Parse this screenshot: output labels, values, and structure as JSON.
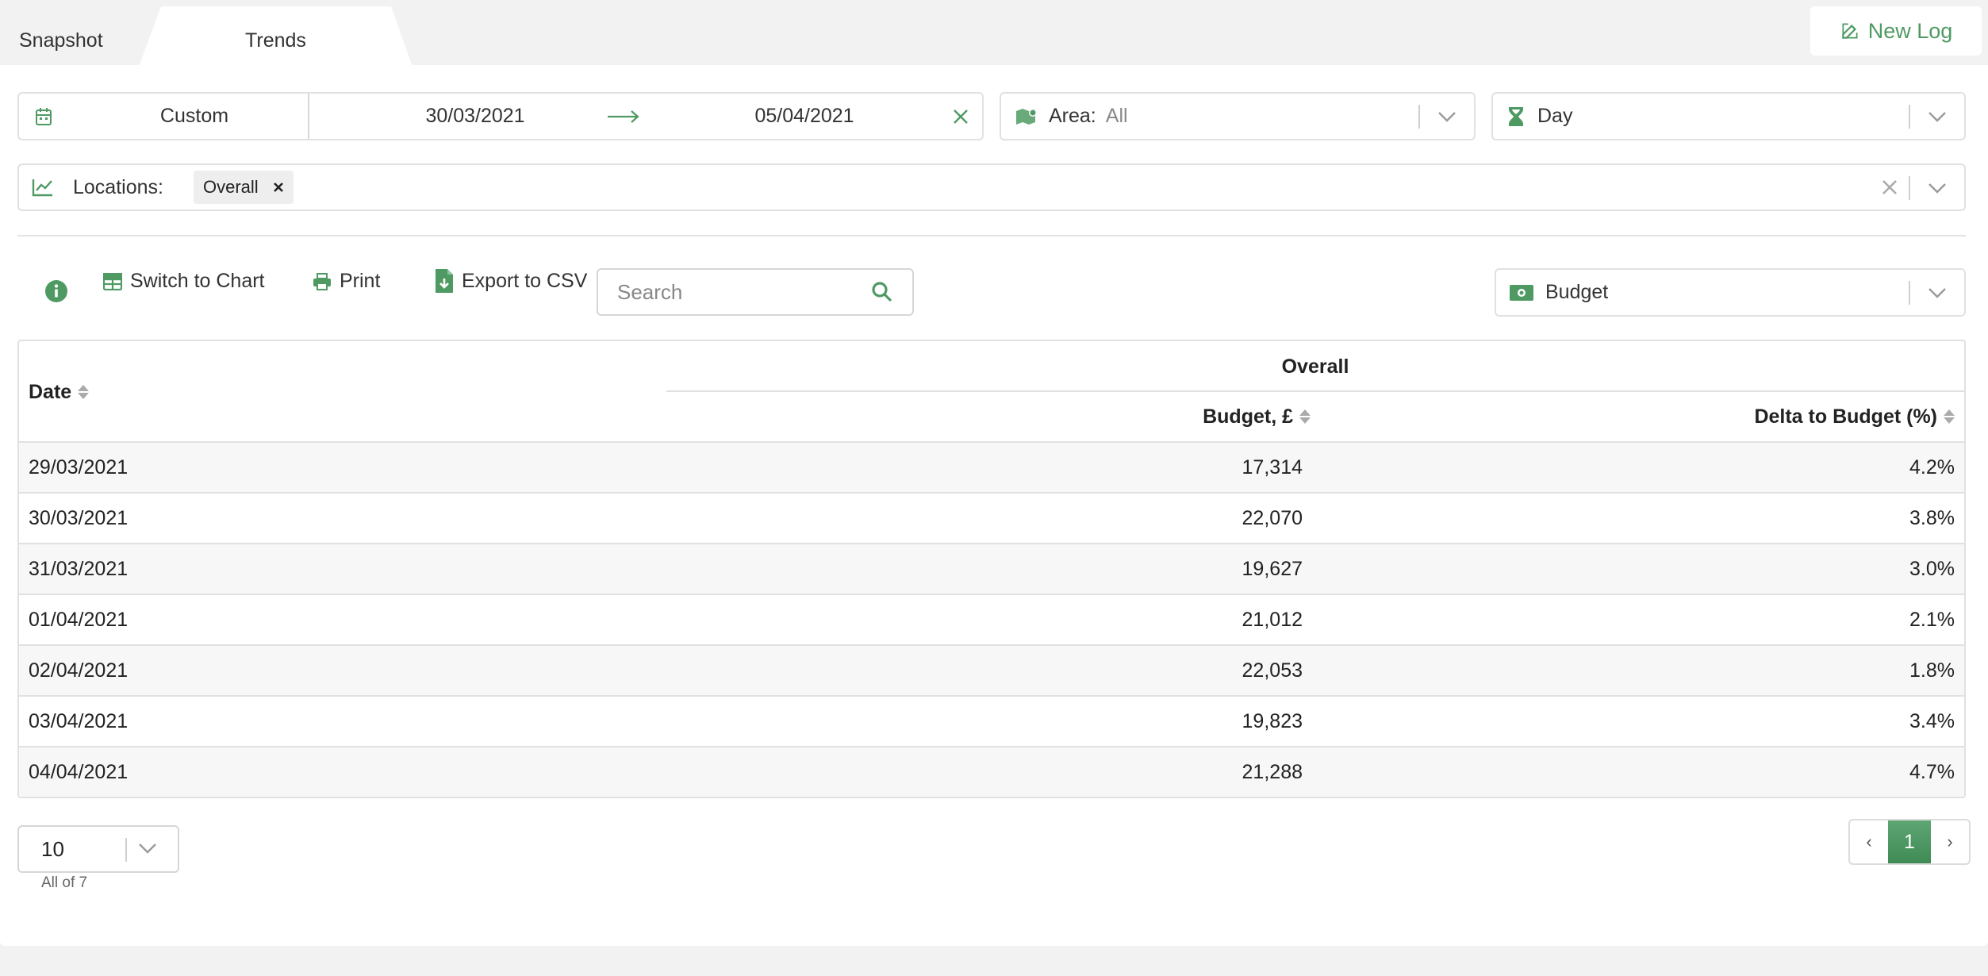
{
  "tabs": [
    {
      "label": "Snapshot",
      "active": false
    },
    {
      "label": "Trends",
      "active": true
    }
  ],
  "new_log": {
    "label": "New Log"
  },
  "filters": {
    "date_range": {
      "mode": "Custom",
      "start": "30/03/2021",
      "end": "05/04/2021"
    },
    "area": {
      "label": "Area:",
      "value": "All"
    },
    "granularity": {
      "value": "Day"
    },
    "locations": {
      "label": "Locations:",
      "chips": [
        "Overall"
      ]
    }
  },
  "toolbar": {
    "switch_label": "Switch to Chart",
    "print_label": "Print",
    "export_label": "Export to CSV",
    "search_placeholder": "Search",
    "metric": {
      "value": "Budget"
    }
  },
  "table": {
    "group_header": "Overall",
    "headers": {
      "date": "Date",
      "budget": "Budget, £",
      "delta": "Delta to Budget (%)"
    },
    "rows": [
      {
        "date": "29/03/2021",
        "budget": "17,314",
        "delta": "4.2%"
      },
      {
        "date": "30/03/2021",
        "budget": "22,070",
        "delta": "3.8%"
      },
      {
        "date": "31/03/2021",
        "budget": "19,627",
        "delta": "3.0%"
      },
      {
        "date": "01/04/2021",
        "budget": "21,012",
        "delta": "2.1%"
      },
      {
        "date": "02/04/2021",
        "budget": "22,053",
        "delta": "1.8%"
      },
      {
        "date": "03/04/2021",
        "budget": "19,823",
        "delta": "3.4%"
      },
      {
        "date": "04/04/2021",
        "budget": "21,288",
        "delta": "4.7%"
      }
    ]
  },
  "footer": {
    "page_size": "10",
    "count_text": "All of 7",
    "pager": {
      "prev": "‹",
      "current": "1",
      "next": "›"
    }
  },
  "colors": {
    "accent": "#4f9a63",
    "border": "#e1e1e1",
    "background": "#f2f2f2"
  }
}
